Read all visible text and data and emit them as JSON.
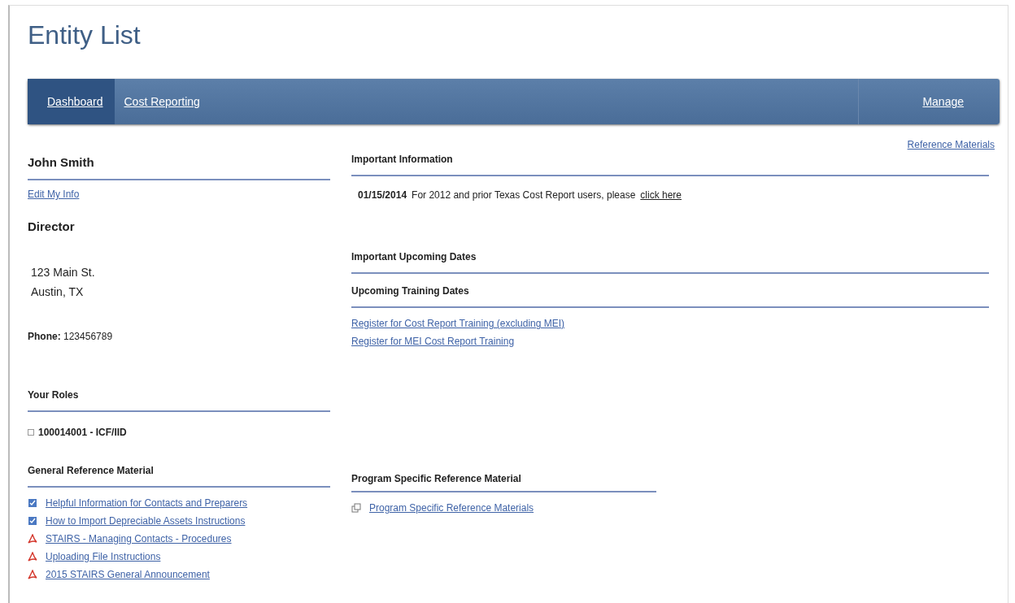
{
  "page_title": "Entity List",
  "nav": {
    "tabs": [
      {
        "label": "Dashboard",
        "selected": true
      },
      {
        "label": "Cost Reporting",
        "selected": false
      }
    ],
    "right_link": "Manage"
  },
  "reference_link": "Reference Materials",
  "profile": {
    "name": "John Smith",
    "edit_link": "Edit My Info",
    "title": "Director",
    "address_lines": [
      "123 Main St.",
      "Austin, TX"
    ],
    "phone": "**Phone:** 123456789"
  },
  "roles": {
    "heading": "Your Roles",
    "items": [
      "100014001 - ICF/IID"
    ]
  },
  "general_reference": {
    "heading": "General Reference Material",
    "links": [
      {
        "kind": "document",
        "label": "Helpful Information for Contacts and Preparers"
      },
      {
        "kind": "document",
        "label": "How to Import Depreciable Assets Instructions"
      },
      {
        "kind": "pdf",
        "label": "STAIRS - Managing Contacts - Procedures"
      },
      {
        "kind": "pdf",
        "label": "Uploading File Instructions"
      },
      {
        "kind": "pdf",
        "label": "2015 STAIRS General Announcement"
      }
    ]
  },
  "important_information": {
    "heading": "Important Information",
    "items": [
      {
        "date": "01/15/2014",
        "text": "For 2012 and prior Texas Cost Report users, please",
        "link": "click here"
      }
    ]
  },
  "upcoming_dates": {
    "heading": "Important Upcoming Dates"
  },
  "training": {
    "heading": "Upcoming Training Dates",
    "links": [
      "Register for Cost Report Training (excluding MEI)",
      "Register for MEI Cost Report Training"
    ]
  },
  "program_reference": {
    "heading": "Program Specific Reference Material",
    "links": [
      "Program Specific Reference Materials"
    ]
  }
}
